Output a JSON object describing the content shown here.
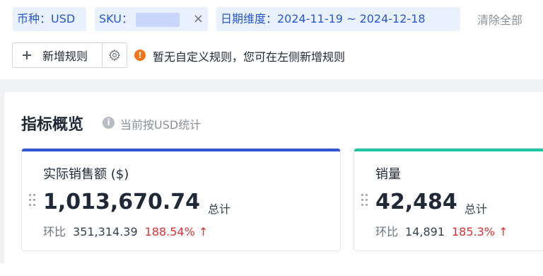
{
  "filters": {
    "currency": "币种：USD",
    "sku_label": "SKU：",
    "date": "日期维度：2024-11-19 ~ 2024-12-18",
    "clear_all": "清除全部",
    "close_glyph": "×"
  },
  "rules": {
    "add_label": "新增规则",
    "notice": "暂无自定义规则，您可在左侧新增规则",
    "notice_glyph": "!"
  },
  "overview": {
    "title": "指标概览",
    "note": "当前按USD统计",
    "note_glyph": "i"
  },
  "cards": [
    {
      "label": "实际销售额 ($)",
      "value": "1,013,670.74",
      "unit": "总计",
      "compare_label": "环比",
      "compare_value": "351,314.39",
      "compare_rate": "188.54% ↑",
      "accent_color": "#2f54d4"
    },
    {
      "label": "销量",
      "value": "42,484",
      "unit": "总计",
      "compare_label": "环比",
      "compare_value": "14,891",
      "compare_rate": "185.3% ↑",
      "accent_color": "#20c7a0"
    }
  ],
  "colors": {
    "tag_bg": "#eaf1fe",
    "tag_text": "#2557d6",
    "increase": "#e03131",
    "warning": "#f97316"
  }
}
